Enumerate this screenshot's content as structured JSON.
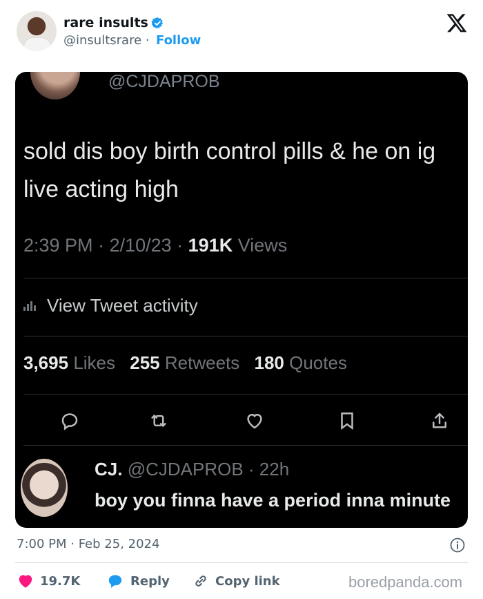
{
  "account": {
    "name": "rare insults",
    "handle": "@insultsrare",
    "separator": "·",
    "follow_label": "Follow",
    "brand_color": "#1d9bf0",
    "logo_icon": "x-logo-icon",
    "verified_icon": "verified-badge-icon"
  },
  "embedded_tweet": {
    "top_handle": "@CJDAPROB",
    "text": "sold dis boy birth control pills & he on ig live acting high",
    "meta": {
      "time": "2:39 PM",
      "date": "2/10/23",
      "views_count": "191K",
      "views_label": "Views"
    },
    "activity_label": "View Tweet activity",
    "stats": {
      "likes_count": "3,695",
      "likes_label": "Likes",
      "retweets_count": "255",
      "retweets_label": "Retweets",
      "quotes_count": "180",
      "quotes_label": "Quotes"
    },
    "actions": [
      "reply-icon",
      "retweet-icon",
      "like-icon",
      "bookmark-icon",
      "share-icon"
    ],
    "reply": {
      "name": "CJ.",
      "handle": "@CJDAPROB",
      "age": "22h",
      "text": "boy you finna have a period inna minute"
    }
  },
  "footer": {
    "timestamp": "7:00 PM · Feb 25, 2024",
    "likes_count": "19.7K",
    "reply_label": "Reply",
    "copy_link_label": "Copy link",
    "like_color": "#f91880",
    "reply_color": "#1d9bf0"
  },
  "watermark": "boredpanda.com"
}
